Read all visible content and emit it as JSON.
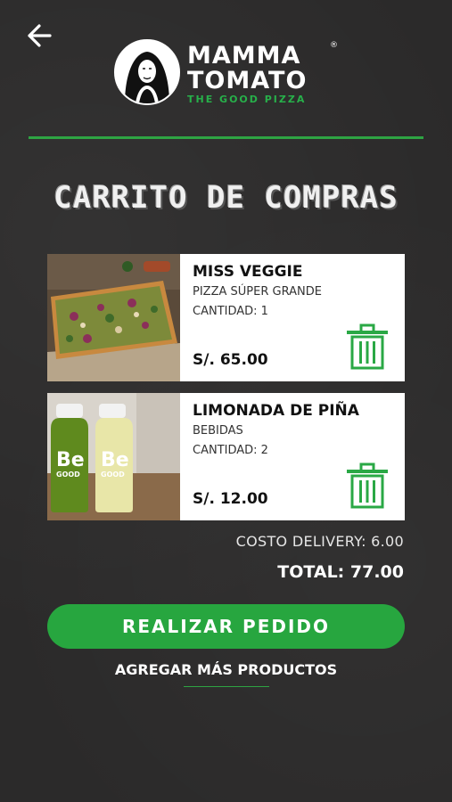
{
  "header": {
    "back_icon": "arrow-left-icon",
    "logo": {
      "line1": "MAMMA",
      "line2": "TOMATO",
      "registered": "®",
      "tagline": "THE GOOD PIZZA"
    }
  },
  "page_title": "CARRITO DE COMPRAS",
  "cart": {
    "items": [
      {
        "name": "MISS VEGGIE",
        "category": "PIZZA SÚPER GRANDE",
        "quantity": "CANTIDAD: 1",
        "price": "S/. 65.00",
        "image": "pizza-image",
        "delete_icon": "trash-icon"
      },
      {
        "name": "LIMONADA DE PIÑA",
        "category": "BEBIDAS",
        "quantity": "CANTIDAD: 2",
        "price": "S/. 12.00",
        "image": "drinks-image",
        "delete_icon": "trash-icon"
      }
    ]
  },
  "summary": {
    "delivery": "COSTO DELIVERY: 6.00",
    "total": "TOTAL: 77.00"
  },
  "actions": {
    "order_button": "REALIZAR PEDIDO",
    "add_more_link": "AGREGAR MÁS PRODUCTOS"
  },
  "colors": {
    "background": "#2b2a2a",
    "accent_green": "#27a63f",
    "card": "#ffffff"
  }
}
